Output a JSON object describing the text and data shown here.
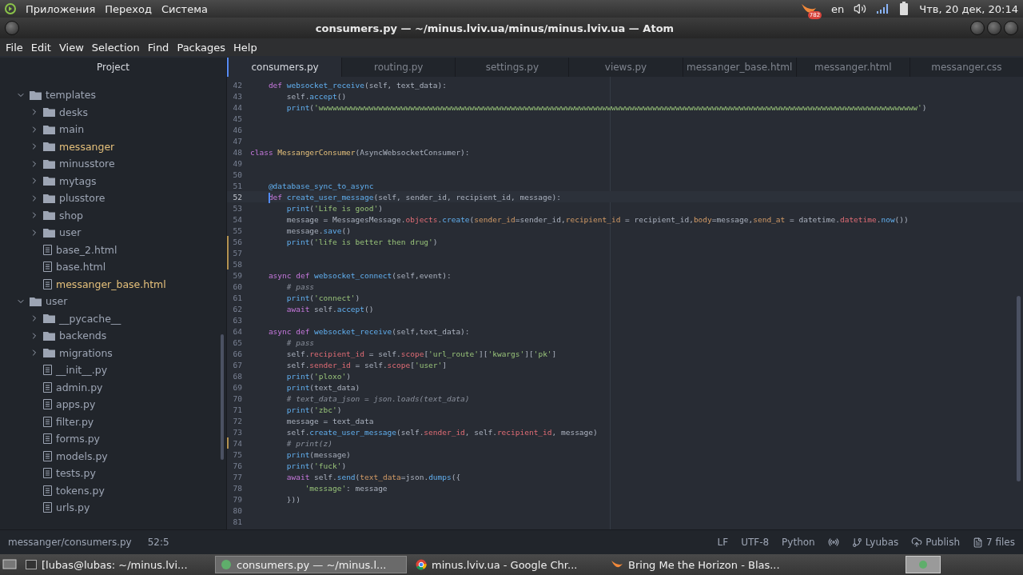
{
  "top_panel": {
    "menus": [
      "Приложения",
      "Переход",
      "Система"
    ],
    "badge": "782",
    "keyboard_layout": "en",
    "clock": "Чтв, 20 дек, 20:14"
  },
  "window": {
    "title": "consumers.py — ~/minus.lviv.ua/minus/minus.lviv.ua — Atom"
  },
  "menu_bar": [
    "File",
    "Edit",
    "View",
    "Selection",
    "Find",
    "Packages",
    "Help"
  ],
  "sidebar": {
    "title": "Project",
    "tree": [
      {
        "name": "templates",
        "kind": "folder",
        "expanded": true,
        "modified": false,
        "children": [
          {
            "name": "desks",
            "kind": "folder",
            "expanded": false,
            "modified": false
          },
          {
            "name": "main",
            "kind": "folder",
            "expanded": false,
            "modified": false
          },
          {
            "name": "messanger",
            "kind": "folder",
            "expanded": false,
            "modified": true
          },
          {
            "name": "minusstore",
            "kind": "folder",
            "expanded": false,
            "modified": false
          },
          {
            "name": "mytags",
            "kind": "folder",
            "expanded": false,
            "modified": false
          },
          {
            "name": "plusstore",
            "kind": "folder",
            "expanded": false,
            "modified": false
          },
          {
            "name": "shop",
            "kind": "folder",
            "expanded": false,
            "modified": false
          },
          {
            "name": "user",
            "kind": "folder",
            "expanded": false,
            "modified": false
          },
          {
            "name": "base_2.html",
            "kind": "file",
            "modified": false
          },
          {
            "name": "base.html",
            "kind": "file",
            "modified": false
          },
          {
            "name": "messanger_base.html",
            "kind": "file",
            "modified": true
          }
        ]
      },
      {
        "name": "user",
        "kind": "folder",
        "expanded": true,
        "modified": false,
        "children": [
          {
            "name": "__pycache__",
            "kind": "folder",
            "expanded": false,
            "modified": false
          },
          {
            "name": "backends",
            "kind": "folder",
            "expanded": false,
            "modified": false
          },
          {
            "name": "migrations",
            "kind": "folder",
            "expanded": false,
            "modified": false
          },
          {
            "name": "__init__.py",
            "kind": "file",
            "modified": false
          },
          {
            "name": "admin.py",
            "kind": "file",
            "modified": false
          },
          {
            "name": "apps.py",
            "kind": "file",
            "modified": false
          },
          {
            "name": "filter.py",
            "kind": "file",
            "modified": false
          },
          {
            "name": "forms.py",
            "kind": "file",
            "modified": false
          },
          {
            "name": "models.py",
            "kind": "file",
            "modified": false
          },
          {
            "name": "tests.py",
            "kind": "file",
            "modified": false
          },
          {
            "name": "tokens.py",
            "kind": "file",
            "modified": false
          },
          {
            "name": "urls.py",
            "kind": "file",
            "modified": false
          }
        ]
      }
    ]
  },
  "tabs": [
    {
      "label": "consumers.py",
      "selected": true
    },
    {
      "label": "routing.py",
      "selected": false
    },
    {
      "label": "settings.py",
      "selected": false
    },
    {
      "label": "views.py",
      "selected": false
    },
    {
      "label": "messanger_base.html",
      "selected": false
    },
    {
      "label": "messanger.html",
      "selected": false
    },
    {
      "label": "messanger.css",
      "selected": false
    }
  ],
  "editor": {
    "lines": [
      {
        "no": "42",
        "current": false,
        "modified": false,
        "kind": "member",
        "tokens": [
          {
            "text": "def",
            "kind": "kw"
          },
          {
            "text": " websocket_receive",
            "kind": "fn"
          },
          {
            "text": "(self, text_data):",
            "kind": "p"
          }
        ]
      },
      {
        "no": "43",
        "current": false,
        "modified": false,
        "kind": "body",
        "tokens": [
          {
            "text": "self.",
            "kind": "p"
          },
          {
            "text": "accept",
            "kind": "fn"
          },
          {
            "text": "()",
            "kind": "p"
          }
        ]
      },
      {
        "no": "44",
        "current": false,
        "modified": false,
        "kind": "body",
        "tokens": [
          {
            "text": "print",
            "kind": "fn"
          },
          {
            "text": "(",
            "kind": "p"
          },
          {
            "text": "'wwwwwwwwwwwwwwwwwwwwwwwwwwwwwwwwwwwwwwwwwwwwwwwwwwwwwwwwwwwwwwwwwwwwwwwwwwwwwwwwwwwwwwwwwwwwwwwwwwwwwwwwwwwwwwwwwwwwwwwwwwwwwwwwwww'",
            "kind": "str"
          },
          {
            "text": ")",
            "kind": "p"
          }
        ]
      },
      {
        "no": "45",
        "current": false,
        "modified": false,
        "kind": "blank"
      },
      {
        "no": "46",
        "current": false,
        "modified": false,
        "kind": "blank"
      },
      {
        "no": "47",
        "current": false,
        "modified": false,
        "kind": "blank"
      },
      {
        "no": "48",
        "current": false,
        "modified": false,
        "kind": "top",
        "tokens": [
          {
            "text": "class",
            "kind": "kw"
          },
          {
            "text": " MessangerConsumer",
            "kind": "cls"
          },
          {
            "text": "(AsyncWebsocketConsumer):",
            "kind": "p"
          }
        ]
      },
      {
        "no": "49",
        "current": false,
        "modified": false,
        "kind": "blank"
      },
      {
        "no": "50",
        "current": false,
        "modified": false,
        "kind": "blank"
      },
      {
        "no": "51",
        "current": false,
        "modified": false,
        "kind": "member",
        "tokens": [
          {
            "text": "@database_sync_to_async",
            "kind": "fn"
          }
        ]
      },
      {
        "no": "52",
        "current": true,
        "modified": false,
        "kind": "member",
        "tokens": [
          {
            "text": "def",
            "kind": "kw"
          },
          {
            "text": " create_user_message",
            "kind": "fn"
          },
          {
            "text": "(self, sender_id, recipient_id, message):",
            "kind": "p"
          }
        ]
      },
      {
        "no": "53",
        "current": false,
        "modified": false,
        "kind": "body",
        "tokens": [
          {
            "text": "print",
            "kind": "fn"
          },
          {
            "text": "(",
            "kind": "p"
          },
          {
            "text": "'Life is good'",
            "kind": "str"
          },
          {
            "text": ")",
            "kind": "p"
          }
        ]
      },
      {
        "no": "54",
        "current": false,
        "modified": false,
        "kind": "body",
        "tokens": [
          {
            "text": "message = MessagesMessage.",
            "kind": "p"
          },
          {
            "text": "objects",
            "kind": "prop"
          },
          {
            "text": ".",
            "kind": "p"
          },
          {
            "text": "create",
            "kind": "fn"
          },
          {
            "text": "(",
            "kind": "p"
          },
          {
            "text": "sender_id",
            "kind": "arg"
          },
          {
            "text": "=sender_id,",
            "kind": "p"
          },
          {
            "text": "recipient_id",
            "kind": "arg"
          },
          {
            "text": " = recipient_id,",
            "kind": "p"
          },
          {
            "text": "body",
            "kind": "arg"
          },
          {
            "text": "=message,",
            "kind": "p"
          },
          {
            "text": "send_at",
            "kind": "arg"
          },
          {
            "text": " = datetime.",
            "kind": "p"
          },
          {
            "text": "datetime",
            "kind": "prop"
          },
          {
            "text": ".",
            "kind": "p"
          },
          {
            "text": "now",
            "kind": "fn"
          },
          {
            "text": "())",
            "kind": "p"
          }
        ]
      },
      {
        "no": "55",
        "current": false,
        "modified": false,
        "kind": "body",
        "tokens": [
          {
            "text": "message.",
            "kind": "p"
          },
          {
            "text": "save",
            "kind": "fn"
          },
          {
            "text": "()",
            "kind": "p"
          }
        ]
      },
      {
        "no": "56",
        "current": false,
        "modified": true,
        "kind": "body",
        "tokens": [
          {
            "text": "print",
            "kind": "fn"
          },
          {
            "text": "(",
            "kind": "p"
          },
          {
            "text": "'life is better then drug'",
            "kind": "str"
          },
          {
            "text": ")",
            "kind": "p"
          }
        ]
      },
      {
        "no": "57",
        "current": false,
        "modified": true,
        "kind": "blank"
      },
      {
        "no": "58",
        "current": false,
        "modified": true,
        "kind": "blank"
      },
      {
        "no": "59",
        "current": false,
        "modified": false,
        "kind": "member",
        "tokens": [
          {
            "text": "async def",
            "kind": "kw"
          },
          {
            "text": " websocket_connect",
            "kind": "fn"
          },
          {
            "text": "(self,event):",
            "kind": "p"
          }
        ]
      },
      {
        "no": "60",
        "current": false,
        "modified": false,
        "kind": "body",
        "tokens": [
          {
            "text": "# pass",
            "kind": "cmt"
          }
        ]
      },
      {
        "no": "61",
        "current": false,
        "modified": false,
        "kind": "body",
        "tokens": [
          {
            "text": "print",
            "kind": "fn"
          },
          {
            "text": "(",
            "kind": "p"
          },
          {
            "text": "'connect'",
            "kind": "str"
          },
          {
            "text": ")",
            "kind": "p"
          }
        ]
      },
      {
        "no": "62",
        "current": false,
        "modified": false,
        "kind": "body",
        "tokens": [
          {
            "text": "await",
            "kind": "kw"
          },
          {
            "text": " self.",
            "kind": "p"
          },
          {
            "text": "accept",
            "kind": "fn"
          },
          {
            "text": "()",
            "kind": "p"
          }
        ]
      },
      {
        "no": "63",
        "current": false,
        "modified": false,
        "kind": "blank"
      },
      {
        "no": "64",
        "current": false,
        "modified": false,
        "kind": "member",
        "tokens": [
          {
            "text": "async def",
            "kind": "kw"
          },
          {
            "text": " websocket_receive",
            "kind": "fn"
          },
          {
            "text": "(self,text_data):",
            "kind": "p"
          }
        ]
      },
      {
        "no": "65",
        "current": false,
        "modified": false,
        "kind": "body",
        "tokens": [
          {
            "text": "# pass",
            "kind": "cmt"
          }
        ]
      },
      {
        "no": "66",
        "current": false,
        "modified": false,
        "kind": "body",
        "tokens": [
          {
            "text": "self.",
            "kind": "p"
          },
          {
            "text": "recipient_id",
            "kind": "prop"
          },
          {
            "text": " = self.",
            "kind": "p"
          },
          {
            "text": "scope",
            "kind": "prop"
          },
          {
            "text": "[",
            "kind": "p"
          },
          {
            "text": "'url_route'",
            "kind": "str"
          },
          {
            "text": "][",
            "kind": "p"
          },
          {
            "text": "'kwargs'",
            "kind": "str"
          },
          {
            "text": "][",
            "kind": "p"
          },
          {
            "text": "'pk'",
            "kind": "str"
          },
          {
            "text": "]",
            "kind": "p"
          }
        ]
      },
      {
        "no": "67",
        "current": false,
        "modified": false,
        "kind": "body",
        "tokens": [
          {
            "text": "self.",
            "kind": "p"
          },
          {
            "text": "sender_id",
            "kind": "prop"
          },
          {
            "text": " = self.",
            "kind": "p"
          },
          {
            "text": "scope",
            "kind": "prop"
          },
          {
            "text": "[",
            "kind": "p"
          },
          {
            "text": "'user'",
            "kind": "str"
          },
          {
            "text": "]",
            "kind": "p"
          }
        ]
      },
      {
        "no": "68",
        "current": false,
        "modified": false,
        "kind": "body",
        "tokens": [
          {
            "text": "print",
            "kind": "fn"
          },
          {
            "text": "(",
            "kind": "p"
          },
          {
            "text": "'ploxo'",
            "kind": "str"
          },
          {
            "text": ")",
            "kind": "p"
          }
        ]
      },
      {
        "no": "69",
        "current": false,
        "modified": false,
        "kind": "body",
        "tokens": [
          {
            "text": "print",
            "kind": "fn"
          },
          {
            "text": "(text_data)",
            "kind": "p"
          }
        ]
      },
      {
        "no": "70",
        "current": false,
        "modified": false,
        "kind": "body",
        "tokens": [
          {
            "text": "# text_data_json = json.loads(text_data)",
            "kind": "cmt"
          }
        ]
      },
      {
        "no": "71",
        "current": false,
        "modified": false,
        "kind": "body",
        "tokens": [
          {
            "text": "print",
            "kind": "fn"
          },
          {
            "text": "(",
            "kind": "p"
          },
          {
            "text": "'zbc'",
            "kind": "str"
          },
          {
            "text": ")",
            "kind": "p"
          }
        ]
      },
      {
        "no": "72",
        "current": false,
        "modified": false,
        "kind": "body",
        "tokens": [
          {
            "text": "message = text_data",
            "kind": "p"
          }
        ]
      },
      {
        "no": "73",
        "current": false,
        "modified": false,
        "kind": "body",
        "tokens": [
          {
            "text": "self.",
            "kind": "p"
          },
          {
            "text": "create_user_message",
            "kind": "fn"
          },
          {
            "text": "(self.",
            "kind": "p"
          },
          {
            "text": "sender_id",
            "kind": "prop"
          },
          {
            "text": ", self.",
            "kind": "p"
          },
          {
            "text": "recipient_id",
            "kind": "prop"
          },
          {
            "text": ", message)",
            "kind": "p"
          }
        ]
      },
      {
        "no": "74",
        "current": false,
        "modified": true,
        "kind": "body",
        "tokens": [
          {
            "text": "# print(z)",
            "kind": "cmt"
          }
        ]
      },
      {
        "no": "75",
        "current": false,
        "modified": false,
        "kind": "body",
        "tokens": [
          {
            "text": "print",
            "kind": "fn"
          },
          {
            "text": "(message)",
            "kind": "p"
          }
        ]
      },
      {
        "no": "76",
        "current": false,
        "modified": false,
        "kind": "body",
        "tokens": [
          {
            "text": "print",
            "kind": "fn"
          },
          {
            "text": "(",
            "kind": "p"
          },
          {
            "text": "'fuck'",
            "kind": "str"
          },
          {
            "text": ")",
            "kind": "p"
          }
        ]
      },
      {
        "no": "77",
        "current": false,
        "modified": false,
        "kind": "body",
        "tokens": [
          {
            "text": "await",
            "kind": "kw"
          },
          {
            "text": " self.",
            "kind": "p"
          },
          {
            "text": "send",
            "kind": "fn"
          },
          {
            "text": "(",
            "kind": "p"
          },
          {
            "text": "text_data",
            "kind": "arg"
          },
          {
            "text": "=json.",
            "kind": "p"
          },
          {
            "text": "dumps",
            "kind": "fn"
          },
          {
            "text": "({",
            "kind": "p"
          }
        ]
      },
      {
        "no": "78",
        "current": false,
        "modified": false,
        "kind": "inner",
        "tokens": [
          {
            "text": "'message'",
            "kind": "str"
          },
          {
            "text": ": message",
            "kind": "p"
          }
        ]
      },
      {
        "no": "79",
        "current": false,
        "modified": false,
        "kind": "body",
        "tokens": [
          {
            "text": "}))",
            "kind": "p"
          }
        ]
      },
      {
        "no": "80",
        "current": false,
        "modified": false,
        "kind": "blank"
      },
      {
        "no": "81",
        "current": false,
        "modified": false,
        "kind": "blank"
      }
    ]
  },
  "status_bar": {
    "file": "messanger/consumers.py",
    "cursor": "52:5",
    "line_ending": "LF",
    "encoding": "UTF-8",
    "grammar": "Python",
    "branch": "Lyubas",
    "publish": "Publish",
    "changes": "7 files"
  },
  "taskbar": {
    "tasks": [
      {
        "label": "[lubas@lubas: ~/minus.lvi...",
        "kind": "terminal",
        "selected": false
      },
      {
        "label": "consumers.py — ~/minus.l...",
        "kind": "editor",
        "selected": true
      },
      {
        "label": "minus.lviv.ua - Google Chr...",
        "kind": "browser",
        "selected": false
      },
      {
        "label": "Bring Me the Horizon - Blas...",
        "kind": "player",
        "selected": false
      }
    ]
  }
}
